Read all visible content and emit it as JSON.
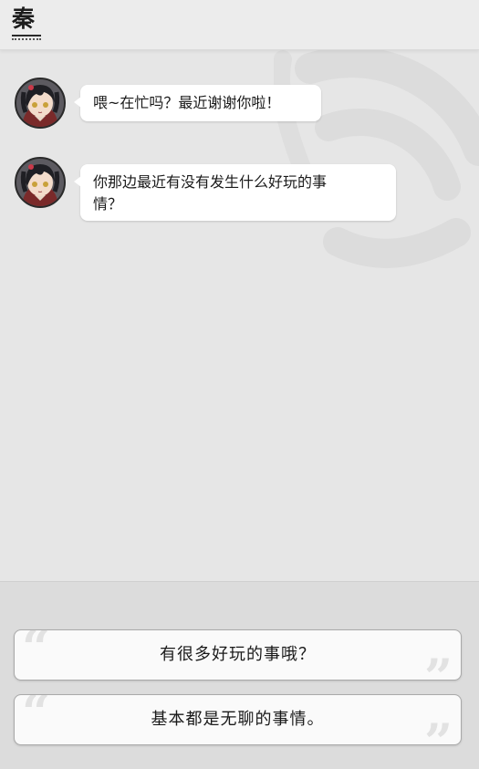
{
  "header": {
    "contact_name": "秦"
  },
  "messages": [
    {
      "text": "喂~在忙吗？最近谢谢你啦！"
    },
    {
      "text_line1": "你那边最近有没有发生什么好玩的事",
      "text_line2": "情？"
    }
  ],
  "replies": [
    {
      "label": "有很多好玩的事哦？"
    },
    {
      "label": "基本都是无聊的事情。"
    }
  ],
  "icons": {
    "quote_open": "“",
    "quote_close": "”"
  }
}
